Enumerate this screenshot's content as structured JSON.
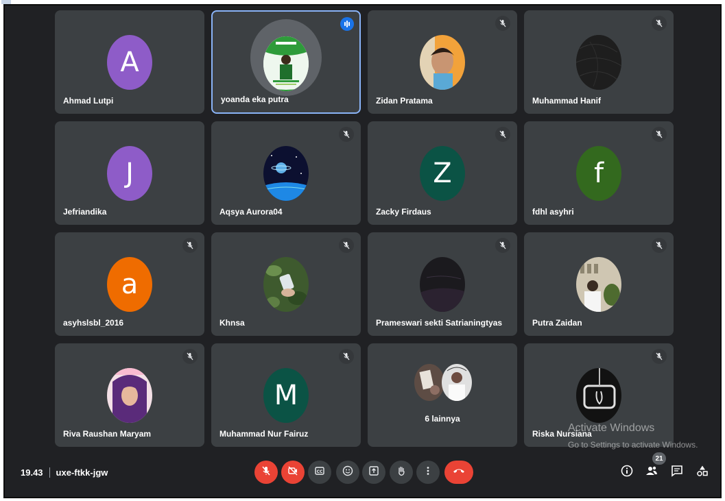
{
  "meeting": {
    "time": "19.43",
    "code": "uxe-ftkk-jgw",
    "participant_count": "21"
  },
  "colors": {
    "background": "#202124",
    "tile": "#3c4043",
    "active_border": "#8ab4f8",
    "danger": "#ea4335",
    "speaking": "#1a73e8"
  },
  "tiles": [
    {
      "name": "Ahmad Lutpi",
      "initial": "A",
      "avatar_color": "#8e5cc8",
      "muted": false
    },
    {
      "name": "yoanda eka putra",
      "avatar": "photo",
      "muted": false,
      "speaking": true
    },
    {
      "name": "Zidan Pratama",
      "avatar": "photo",
      "muted": true
    },
    {
      "name": "Muhammad Hanif",
      "avatar": "photo",
      "muted": true
    },
    {
      "name": "Jefriandika",
      "initial": "J",
      "avatar_color": "#8e5cc8",
      "muted": false
    },
    {
      "name": "Aqsya Aurora04",
      "avatar": "photo",
      "muted": true
    },
    {
      "name": "Zacky Firdaus",
      "initial": "Z",
      "avatar_color": "#0b5345",
      "muted": true
    },
    {
      "name": "fdhl asyhri",
      "initial": "f",
      "avatar_color": "#33691e",
      "muted": true
    },
    {
      "name": "asyhslsbl_2016",
      "initial": "a",
      "avatar_color": "#ef6c00",
      "muted": true
    },
    {
      "name": "Khnsa",
      "avatar": "photo",
      "muted": true
    },
    {
      "name": "Prameswari sekti Satrianingtyas",
      "avatar": "photo",
      "muted": true
    },
    {
      "name": "Putra Zaidan",
      "avatar": "photo",
      "muted": true
    },
    {
      "name": "Riva Raushan Maryam",
      "avatar": "photo",
      "muted": true
    },
    {
      "name": "Muhammad Nur Fairuz",
      "initial": "M",
      "avatar_color": "#0b5345",
      "muted": true
    },
    {
      "others_label": "6 lainnya"
    },
    {
      "name": "Riska Nursiana",
      "avatar": "photo",
      "muted": true
    }
  ],
  "watermark": {
    "title": "Activate Windows",
    "subtitle": "Go to Settings to activate Windows."
  },
  "controls": [
    {
      "icon": "mic-off-icon"
    },
    {
      "icon": "camera-off-icon"
    },
    {
      "icon": "captions-icon"
    },
    {
      "icon": "emoji-icon"
    },
    {
      "icon": "present-icon"
    },
    {
      "icon": "raise-hand-icon"
    },
    {
      "icon": "more-options-icon"
    },
    {
      "icon": "end-call-icon"
    }
  ],
  "right_controls": [
    {
      "icon": "info-icon"
    },
    {
      "icon": "people-icon"
    },
    {
      "icon": "chat-icon"
    },
    {
      "icon": "activities-icon"
    }
  ]
}
